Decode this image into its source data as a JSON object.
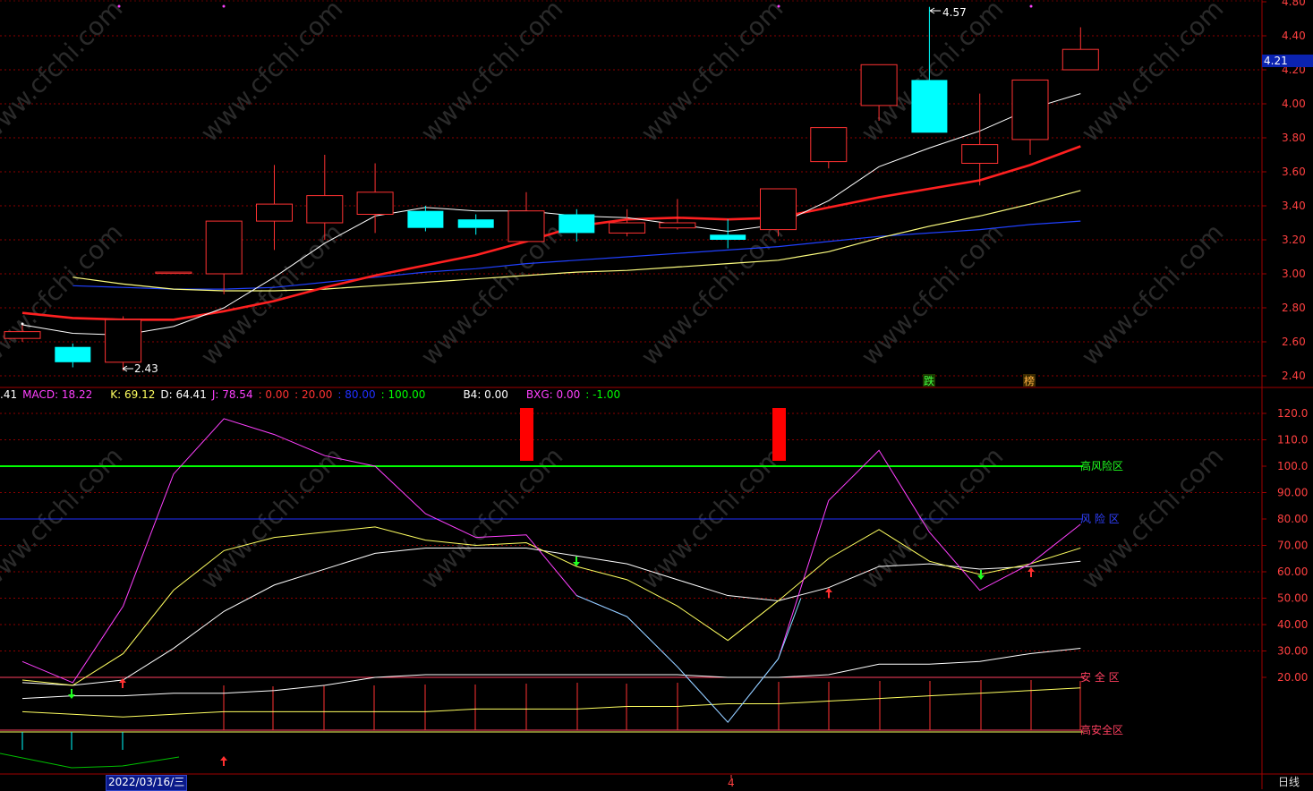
{
  "indicators": {
    "prefix": ".41",
    "macd": "MACD: 18.22",
    "k": "K: 69.12",
    "d": "D: 64.41",
    "j": "J: 78.54",
    "p1": ": 0.00",
    "p2": ": 20.00",
    "p3": ": 80.00",
    "p4": ": 100.00",
    "b4": "B4: 0.00",
    "bxg": "BXG: 0.00",
    "p5": ": -1.00"
  },
  "price_axis_ticks": [
    "4.80",
    "4.40",
    "4.20",
    "4.00",
    "3.80",
    "3.60",
    "3.40",
    "3.20",
    "3.00",
    "2.80",
    "2.60",
    "2.40"
  ],
  "osc_axis_ticks": [
    "120.0",
    "110.0",
    "100.0",
    "90.00",
    "80.00",
    "70.00",
    "60.00",
    "50.00",
    "40.00",
    "30.00",
    "20.00"
  ],
  "current_price": "4.21",
  "high_label": "4.57",
  "low_label": "2.43",
  "zone_labels": {
    "high_risk": "高风险区",
    "risk": "风 险 区",
    "safe": "安 全 区",
    "high_safe": "高安全区"
  },
  "signal_labels": {
    "sell": "跌",
    "buy": "榜"
  },
  "date_label": "2022/03/16/三",
  "month_marker": "4",
  "period": "日线",
  "watermark": "www.cfchi.com",
  "colors": {
    "up": "#ff3232",
    "down": "#00ffff",
    "ma5": "#ffffff",
    "ma10": "#ff2020",
    "ma20": "#ffff80",
    "ma60": "#2040ff",
    "j": "#ff40ff",
    "k": "#ffff60",
    "d": "#ffffff",
    "grid": "#8b0000",
    "zone_high": "#00ff00",
    "zone_risk": "#2030ff"
  },
  "chart_data": {
    "type": "candlestick",
    "candles": [
      {
        "o": 2.62,
        "c": 2.66,
        "h": 2.7,
        "l": 2.6
      },
      {
        "o": 2.57,
        "c": 2.48,
        "h": 2.59,
        "l": 2.45
      },
      {
        "o": 2.48,
        "c": 2.73,
        "h": 2.75,
        "l": 2.43
      },
      {
        "o": 3.01,
        "c": 3.01,
        "h": 3.01,
        "l": 3.01
      },
      {
        "o": 3.0,
        "c": 3.31,
        "h": 3.31,
        "l": 2.88
      },
      {
        "o": 3.31,
        "c": 3.41,
        "h": 3.64,
        "l": 3.14
      },
      {
        "o": 3.3,
        "c": 3.46,
        "h": 3.7,
        "l": 3.2
      },
      {
        "o": 3.35,
        "c": 3.48,
        "h": 3.65,
        "l": 3.24
      },
      {
        "o": 3.37,
        "c": 3.27,
        "h": 3.4,
        "l": 3.25
      },
      {
        "o": 3.32,
        "c": 3.27,
        "h": 3.35,
        "l": 3.23
      },
      {
        "o": 3.19,
        "c": 3.37,
        "h": 3.48,
        "l": 3.19
      },
      {
        "o": 3.35,
        "c": 3.24,
        "h": 3.38,
        "l": 3.19
      },
      {
        "o": 3.24,
        "c": 3.3,
        "h": 3.38,
        "l": 3.22
      },
      {
        "o": 3.27,
        "c": 3.3,
        "h": 3.44,
        "l": 3.26
      },
      {
        "o": 3.23,
        "c": 3.2,
        "h": 3.32,
        "l": 3.15
      },
      {
        "o": 3.26,
        "c": 3.5,
        "h": 3.5,
        "l": 3.22
      },
      {
        "o": 3.66,
        "c": 3.86,
        "h": 3.86,
        "l": 3.62
      },
      {
        "o": 3.99,
        "c": 4.23,
        "h": 4.23,
        "l": 3.9
      },
      {
        "o": 4.14,
        "c": 3.83,
        "h": 4.57,
        "l": 3.83
      },
      {
        "o": 3.65,
        "c": 3.76,
        "h": 4.06,
        "l": 3.52
      },
      {
        "o": 3.79,
        "c": 4.14,
        "h": 4.14,
        "l": 3.7
      },
      {
        "o": 4.2,
        "c": 4.32,
        "h": 4.45,
        "l": 4.2
      }
    ],
    "ma5": [
      2.7,
      2.65,
      2.64,
      2.69,
      2.8,
      2.98,
      3.18,
      3.34,
      3.39,
      3.37,
      3.37,
      3.34,
      3.33,
      3.29,
      3.25,
      3.29,
      3.43,
      3.63,
      3.74,
      3.84,
      3.97,
      4.06
    ],
    "ma10": [
      2.77,
      2.74,
      2.73,
      2.73,
      2.78,
      2.84,
      2.92,
      2.99,
      3.05,
      3.11,
      3.19,
      3.28,
      3.32,
      3.33,
      3.32,
      3.33,
      3.39,
      3.45,
      3.5,
      3.55,
      3.64,
      3.75
    ],
    "ma20": [
      2.98,
      2.94,
      2.91,
      2.9,
      2.9,
      2.91,
      2.93,
      2.95,
      2.97,
      2.99,
      3.01,
      3.02,
      3.04,
      3.06,
      3.08,
      3.13,
      3.21,
      3.28,
      3.34,
      3.41,
      3.49
    ],
    "ma60": [
      2.93,
      2.92,
      2.91,
      2.91,
      2.92,
      2.95,
      2.98,
      3.01,
      3.03,
      3.06,
      3.08,
      3.1,
      3.12,
      3.14,
      3.16,
      3.19,
      3.22,
      3.24,
      3.26,
      3.29,
      3.31
    ],
    "osc": {
      "j": [
        26,
        18,
        47,
        97,
        118,
        112,
        104,
        100,
        82,
        73,
        74,
        51,
        43,
        24,
        3,
        27,
        87,
        106,
        75,
        53,
        63,
        78
      ],
      "k": [
        19,
        17,
        29,
        53,
        68,
        73,
        75,
        77,
        72,
        70,
        71,
        62,
        57,
        47,
        34,
        49,
        65,
        76,
        64,
        59,
        63,
        69
      ],
      "d": [
        18,
        17,
        19,
        31,
        45,
        55,
        61,
        67,
        69,
        69,
        69,
        66,
        63,
        57,
        51,
        49,
        54,
        62,
        63,
        61,
        62,
        64
      ],
      "low_white": [
        12,
        13,
        13,
        14,
        14,
        15,
        17,
        20,
        21,
        21,
        21,
        21,
        21,
        21,
        20,
        20,
        21,
        25,
        25,
        26,
        29,
        31
      ],
      "low_yellow": [
        7,
        6,
        5,
        6,
        7,
        7,
        7,
        7,
        7,
        8,
        8,
        8,
        9,
        9,
        10,
        10,
        11,
        12,
        13,
        14,
        15,
        16
      ]
    },
    "high_risk_level": 100,
    "risk_level": 80,
    "safe_level": 20
  }
}
